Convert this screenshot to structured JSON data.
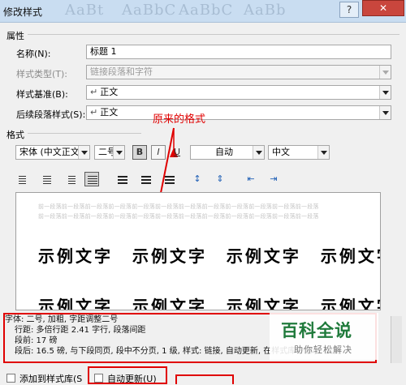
{
  "window": {
    "title": "修改样式",
    "ghost_styles": [
      "AaBt",
      "AaBbC",
      "AaBbC",
      "AaBb"
    ],
    "help_label": "?",
    "close_label": "✕"
  },
  "properties": {
    "section_label": "属性",
    "name_label": "名称(N):",
    "name_value": "标题 1",
    "style_type_label": "样式类型(T):",
    "style_type_value": "链接段落和字符",
    "based_on_label": "样式基准(B):",
    "based_on_value": "正文",
    "following_label": "后续段落样式(S):",
    "following_value": "正文"
  },
  "annotation": "原来的格式",
  "format": {
    "section_label": "格式",
    "font": "宋体 (中文正文)",
    "size": "二号",
    "bold_label": "B",
    "italic_label": "I",
    "underline_label": "U",
    "color": "自动",
    "language": "中文"
  },
  "preview": {
    "gray_line": "前一段落前一段落前一段落前一段落前一段落前一段落前一段落前一段落前一段落前一段落前一段落前一段落",
    "sample_line": "示例文字 示例文字 示例文字 示例文字"
  },
  "description": {
    "line1": "字体: 二号, 加粗, 字距调整二号",
    "line2": "行距: 多倍行距 2.41 字行, 段落间距",
    "line3": "段前: 17 磅",
    "line4": "段后: 16.5 磅, 与下段同页, 段中不分页, 1 级, 样式: 链接, 自动更新, 在样式库中显示, 优先"
  },
  "bottom": {
    "add_to_gallery_label": "添加到样式库(S",
    "auto_update_label": "自动更新(U)"
  },
  "watermark": {
    "logo": "百科全说",
    "sub": "助你轻松解决"
  },
  "colors": {
    "annotation_red": "#e00000",
    "watermark_green": "#1f7a3b"
  }
}
